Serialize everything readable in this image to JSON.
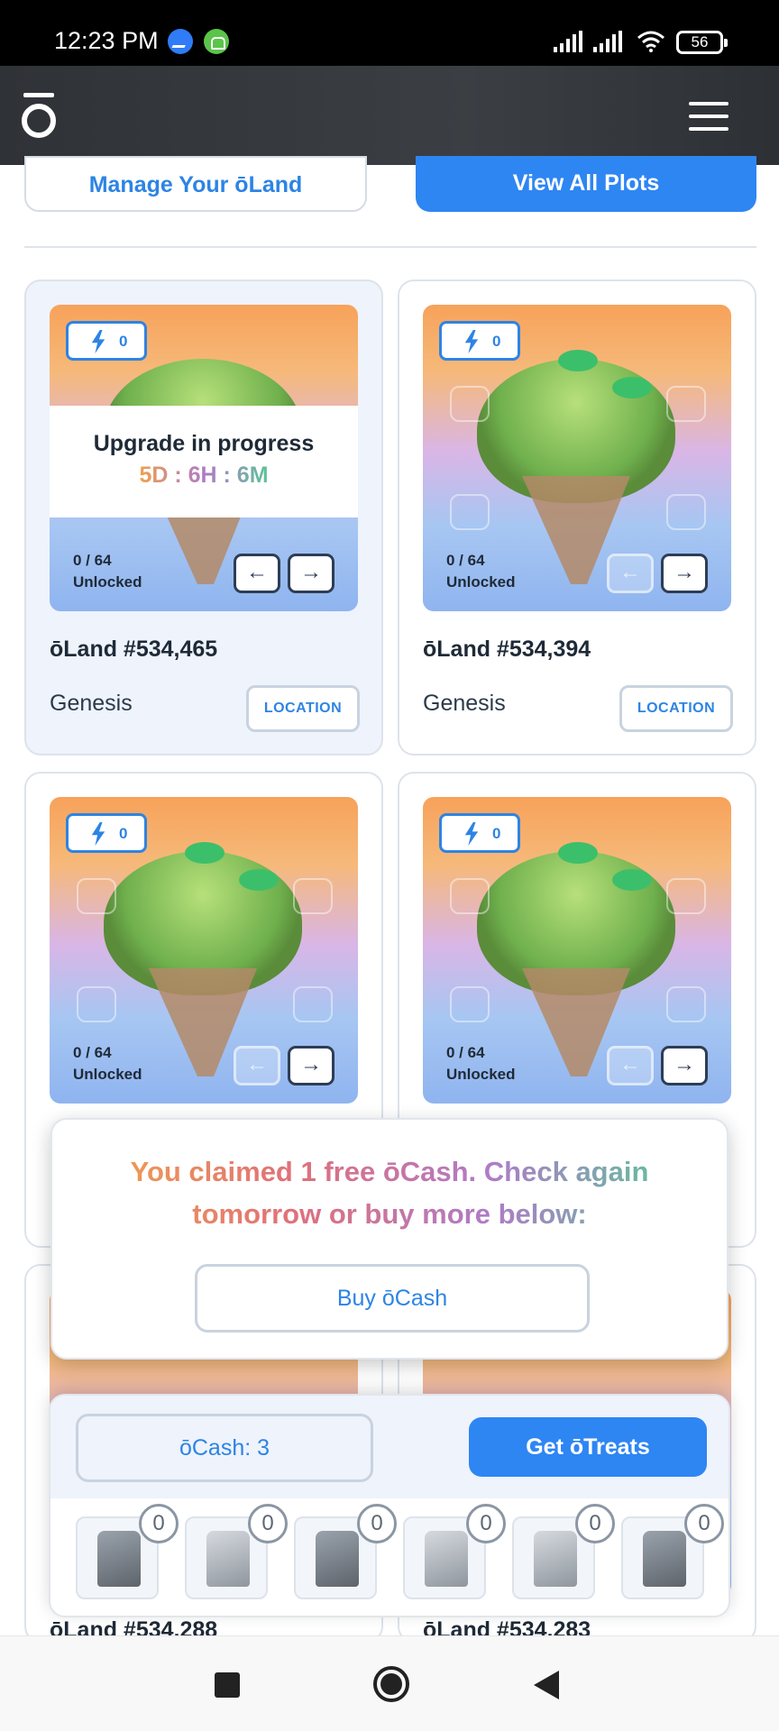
{
  "status_bar": {
    "time": "12:23 PM",
    "icons": [
      "messenger-icon",
      "android-icon",
      "signal-icon",
      "signal-icon",
      "wifi-icon"
    ],
    "battery": "56"
  },
  "header": {
    "logo": "ō",
    "menu_icon": "hamburger-icon"
  },
  "top_actions": {
    "manage_label": "Manage Your ōLand",
    "view_all_label": "View All Plots"
  },
  "cards": [
    {
      "energy": "0",
      "unlocked": "0 / 64",
      "unlocked_label": "Unlocked",
      "upgrade_title": "Upgrade in progress",
      "upgrade_timer": "5D : 6H : 6M",
      "title": "ōLand #534,465",
      "subtitle": "Genesis",
      "location_label": "LOCATION",
      "left_arrow": "←",
      "right_arrow": "→"
    },
    {
      "energy": "0",
      "unlocked": "0 / 64",
      "unlocked_label": "Unlocked",
      "title": "ōLand #534,394",
      "subtitle": "Genesis",
      "location_label": "LOCATION",
      "left_arrow": "←",
      "right_arrow": "→"
    },
    {
      "energy": "0",
      "unlocked": "0 / 64",
      "unlocked_label": "Unlocked",
      "left_arrow": "←",
      "right_arrow": "→"
    },
    {
      "energy": "0",
      "unlocked": "0 / 64",
      "unlocked_label": "Unlocked",
      "left_arrow": "←",
      "right_arrow": "→"
    }
  ],
  "claim_popup": {
    "message": "You claimed 1 free ōCash. Check again tomorrow or buy more below:",
    "buy_label": "Buy ōCash"
  },
  "bottom_sheet": {
    "ocash_label": "ōCash: 3",
    "treats_label": "Get ōTreats",
    "items": [
      {
        "count": "0"
      },
      {
        "count": "0"
      },
      {
        "count": "0"
      },
      {
        "count": "0"
      },
      {
        "count": "0"
      },
      {
        "count": "0"
      }
    ]
  },
  "peek_titles": [
    "ōLand #534,288",
    "ōLand #534,283"
  ],
  "nav": {
    "icons": [
      "recents-icon",
      "home-icon",
      "back-icon"
    ]
  },
  "colors": {
    "accent": "#2e86f3",
    "accent_text": "#2d84e4",
    "header_bg": "#35393e",
    "card_selected_bg": "#eef3fc"
  }
}
